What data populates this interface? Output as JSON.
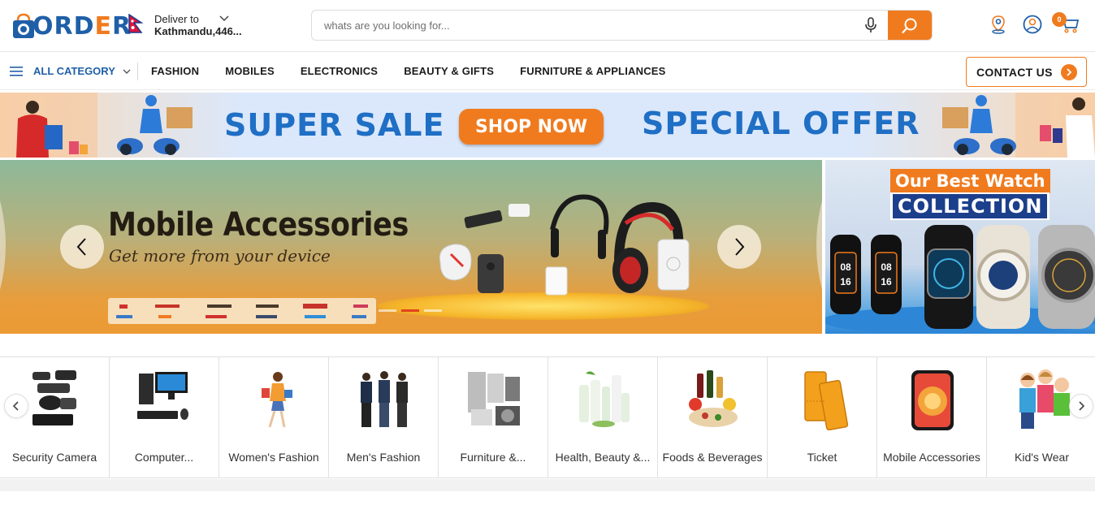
{
  "header": {
    "logo_text": "ORDER",
    "deliver_label": "Deliver to",
    "deliver_location": "Kathmandu,446...",
    "search_placeholder": "whats are you looking for...",
    "cart_count": "0"
  },
  "nav": {
    "all_category": "ALL CATEGORY",
    "links": [
      "FASHION",
      "MOBILES",
      "ELECTRONICS",
      "BEAUTY & GIFTS",
      "FURNITURE & APPLIANCES"
    ],
    "contact": "CONTACT US"
  },
  "promo": {
    "left_text": "SUPER SALE",
    "button": "SHOP NOW",
    "right_text": "SPECIAL OFFER"
  },
  "hero": {
    "title": "Mobile Accessories",
    "subtitle": "Get more from your device"
  },
  "side_banner": {
    "line1": "Our Best Watch",
    "line2": "COLLECTION"
  },
  "categories": [
    {
      "label": "Security Camera",
      "icon": "security-camera-icon"
    },
    {
      "label": "Computer...",
      "icon": "computer-icon"
    },
    {
      "label": "Women's Fashion",
      "icon": "womens-fashion-icon"
    },
    {
      "label": "Men's Fashion",
      "icon": "mens-fashion-icon"
    },
    {
      "label": "Furniture &...",
      "icon": "furniture-icon"
    },
    {
      "label": "Health, Beauty &...",
      "icon": "health-beauty-icon"
    },
    {
      "label": "Foods & Beverages",
      "icon": "foods-beverages-icon"
    },
    {
      "label": "Ticket",
      "icon": "ticket-icon"
    },
    {
      "label": "Mobile Accessories",
      "icon": "mobile-accessories-icon"
    },
    {
      "label": "Kid's Wear",
      "icon": "kids-wear-icon"
    }
  ],
  "colors": {
    "brand_blue": "#1f5fa8",
    "brand_orange": "#f07b1e"
  }
}
